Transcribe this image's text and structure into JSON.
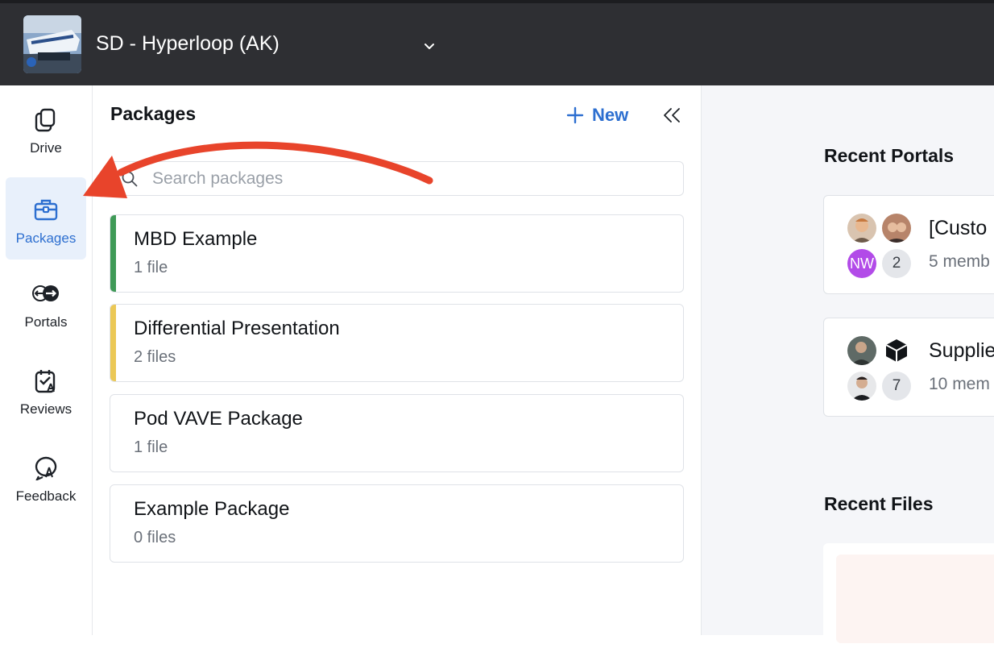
{
  "workspace": {
    "name": "SD - Hyperloop (AK)",
    "logo_icon": "workspace-photo",
    "dropdown_icon": "chevron-down-icon"
  },
  "nav": {
    "items": [
      {
        "label": "Drive",
        "icon": "drive-icon",
        "active": false
      },
      {
        "label": "Packages",
        "icon": "packages-icon",
        "active": true
      },
      {
        "label": "Portals",
        "icon": "portals-icon",
        "active": false
      },
      {
        "label": "Reviews",
        "icon": "reviews-icon",
        "active": false
      },
      {
        "label": "Feedback",
        "icon": "feedback-icon",
        "active": false
      }
    ]
  },
  "packages_panel": {
    "title": "Packages",
    "new_label": "New",
    "search_placeholder": "Search packages",
    "items": [
      {
        "name": "MBD Example",
        "count": "1 file",
        "accent": "#3f9a57"
      },
      {
        "name": "Differential Presentation",
        "count": "2 files",
        "accent": "#ebc856"
      },
      {
        "name": "Pod VAVE Package",
        "count": "1 file",
        "accent": ""
      },
      {
        "name": "Example Package",
        "count": "0 files",
        "accent": ""
      }
    ]
  },
  "main": {
    "recent_portals_title": "Recent Portals",
    "portals": [
      {
        "name": "[Custo",
        "members": "5 memb",
        "initials": "NW",
        "extra_count": "2"
      },
      {
        "name": "Supplie",
        "members": "10 mem",
        "extra_count": "7"
      }
    ],
    "recent_files_title": "Recent Files"
  },
  "colors": {
    "topbar": "#2e2f33",
    "accent": "#2d6fd0",
    "annotation_arrow": "#e8442b"
  }
}
